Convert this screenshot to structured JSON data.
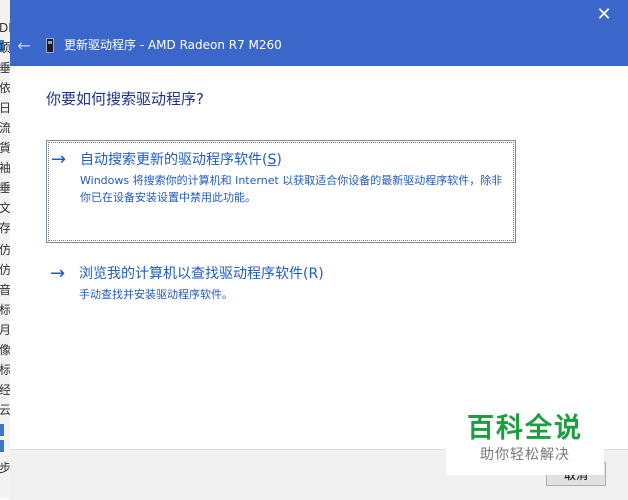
{
  "background_window": {
    "chars": [
      "DE",
      "项",
      "垂",
      "依",
      "日",
      "流",
      "貨",
      "袖",
      "垂",
      "文",
      "存",
      "仿",
      "仿",
      "音",
      "标",
      "月",
      "像",
      "标",
      "经",
      "云",
      "步"
    ]
  },
  "dialog": {
    "title": "更新驱动程序 - AMD Radeon R7 M260",
    "close_glyph": "✕",
    "back_glyph": "←",
    "question": "你要如何搜索驱动程序?",
    "options": [
      {
        "arrow": "→",
        "title_prefix": "自动搜索更新的驱动程序软件(",
        "title_key": "S",
        "title_suffix": ")",
        "description": "Windows 将搜索你的计算机和 Internet 以获取适合你设备的最新驱动程序软件，除非你已在设备安装设置中禁用此功能。"
      },
      {
        "arrow": "→",
        "title": "浏览我的计算机以查找驱动程序软件(R)",
        "description": "手动查找并安装驱动程序软件。"
      }
    ],
    "cancel_label": "取消"
  },
  "watermark": {
    "main": "百科全说",
    "sub": "助你轻松解决"
  },
  "colors": {
    "titlebar": "#3a67c9",
    "link_blue": "#1f5bc4",
    "heading_blue": "#1e3287",
    "watermark_green": "#1b9e3e"
  }
}
